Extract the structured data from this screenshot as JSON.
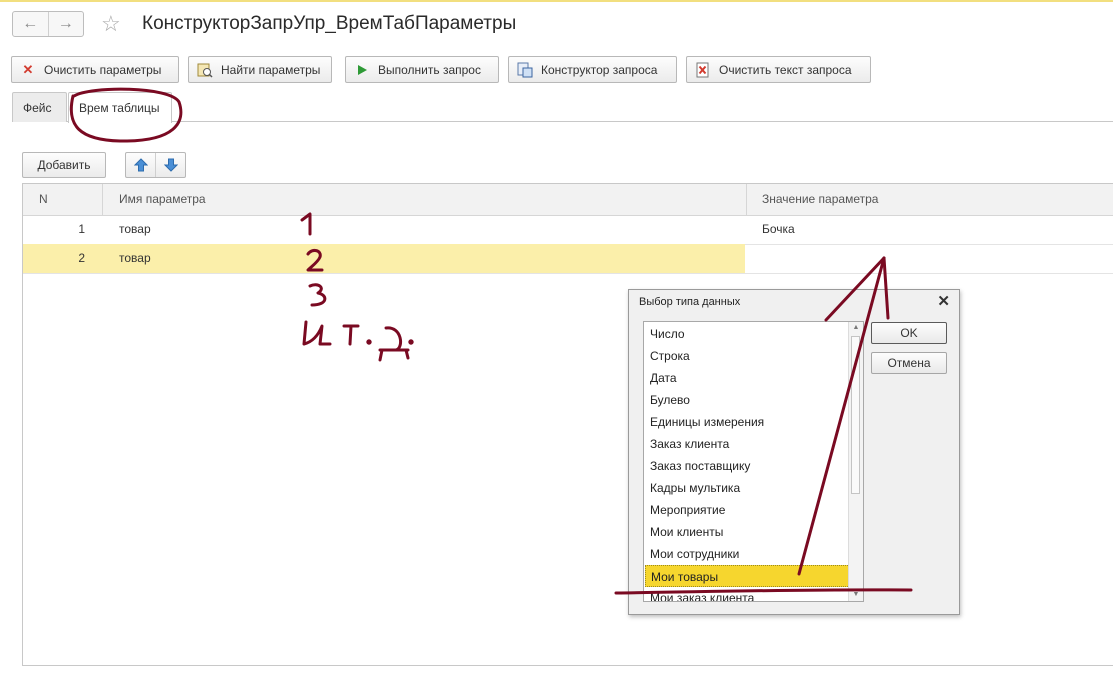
{
  "window": {
    "title": "КонструкторЗапрУпр_ВремТабПараметры",
    "back_icon": "arrow-left-icon",
    "forward_icon": "arrow-right-icon",
    "favorite_icon": "star-icon"
  },
  "toolbar": {
    "buttons": [
      {
        "label": "Очистить параметры",
        "icon": "red-x-icon"
      },
      {
        "label": "Найти параметры",
        "icon": "find-icon"
      },
      {
        "label": "Выполнить запрос",
        "icon": "play-icon"
      },
      {
        "label": "Конструктор запроса",
        "icon": "constructor-icon"
      },
      {
        "label": "Очистить текст запроса",
        "icon": "clear-doc-icon"
      }
    ]
  },
  "tabs": [
    {
      "label": "Фейс",
      "active": false
    },
    {
      "label": "Врем таблицы",
      "active": true
    }
  ],
  "table_toolbar": {
    "add_label": "Добавить",
    "up_icon": "move-up-icon",
    "down_icon": "move-down-icon"
  },
  "table": {
    "columns": [
      "N",
      "Имя параметра",
      "Значение параметра"
    ],
    "rows": [
      {
        "n": "1",
        "name": "товар",
        "value": "Бочка",
        "selected": false
      },
      {
        "n": "2",
        "name": "товар",
        "value": "",
        "selected": true
      }
    ]
  },
  "dialog": {
    "title": "Выбор типа данных",
    "items": [
      "Число",
      "Строка",
      "Дата",
      "Булево",
      "Единицы измерения",
      "Заказ клиента",
      "Заказ поставщику",
      "Кадры мультика",
      "Мероприятие",
      "Мои клиенты",
      "Мои сотрудники",
      "Мои товары",
      "Мои заказ клиента"
    ],
    "selected_item": "Мои товары",
    "ok_label": "OK",
    "cancel_label": "Отмена"
  },
  "colors": {
    "selection_row": "#fbefaa",
    "dialog_selection": "#f6d62e",
    "annotation": "#7a0a22"
  }
}
